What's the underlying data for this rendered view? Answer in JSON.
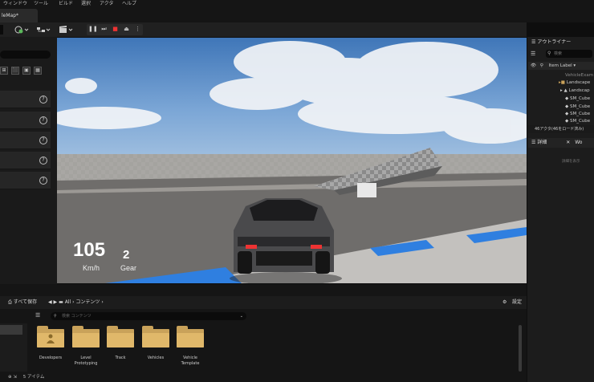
{
  "menu": [
    "ウィンドウ",
    "ツール",
    "ビルド",
    "選択",
    "アクタ",
    "ヘルプ"
  ],
  "tab": {
    "title": "leMap*"
  },
  "toolbar": {
    "pause": "❚❚",
    "step": "⏭",
    "stop": "■",
    "eject": "⏏",
    "more": "⋮"
  },
  "hud": {
    "speed": "105",
    "speed_unit": "Km/h",
    "gear": "2",
    "gear_unit": "Gear"
  },
  "outliner": {
    "title": "アウトライナー",
    "search_placeholder": "検索",
    "column": "Item Label ▾",
    "items": [
      "VehicleExam",
      "Landscape",
      "Landscap",
      "SM_Cube",
      "SM_Cube",
      "SM_Cube",
      "SM_Cube"
    ],
    "count": "46アクタ(46をロード済み)"
  },
  "details": {
    "tab": "詳細",
    "tab2": "Wo",
    "close": "✕",
    "hint": "詳細を表示"
  },
  "content_browser": {
    "save_all": "すべて保存",
    "path_all": "All",
    "path_content": "コンテンツ",
    "settings": "設定",
    "search_placeholder": "検索 コンテンツ",
    "folders": [
      {
        "label": "Developers"
      },
      {
        "label": "Level\nPrototyping"
      },
      {
        "label": "Track"
      },
      {
        "label": "Vehicles"
      },
      {
        "label": "Vehicle\nTemplate"
      }
    ],
    "status": "5 アイテム"
  },
  "colors": {
    "accent_blue": "#2f7fe0",
    "folder": "#c9a25a",
    "sky": "#4f86c6"
  }
}
